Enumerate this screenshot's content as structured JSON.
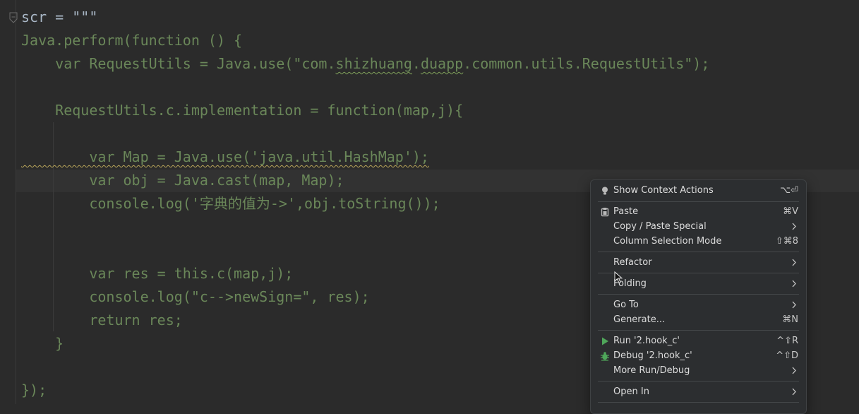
{
  "editor": {
    "lines": [
      {
        "id": "l1",
        "text": "scr = \"\"\""
      },
      {
        "id": "l2",
        "text": "Java.perform(function () {"
      },
      {
        "id": "l3a",
        "text": "    var RequestUtils = Java.use(\"com."
      },
      {
        "id": "l3b",
        "text": "shizhuang"
      },
      {
        "id": "l3c",
        "text": "."
      },
      {
        "id": "l3d",
        "text": "duapp"
      },
      {
        "id": "l3e",
        "text": ".common.utils.RequestUtils\");"
      },
      {
        "id": "l4",
        "text": "    RequestUtils.c.implementation = function(map,j){"
      },
      {
        "id": "l5",
        "text": "        var Map = Java.use('java.util.HashMap');"
      },
      {
        "id": "l6",
        "text": "        var obj = Java.cast(map, Map);"
      },
      {
        "id": "l7",
        "text": "        console.log('字典的值为->',obj.toString());"
      },
      {
        "id": "l8",
        "text": "        var res = this.c(map,j);"
      },
      {
        "id": "l9",
        "text": "        console.log(\"c-->newSign=\", res);"
      },
      {
        "id": "l10",
        "text": "        return res;"
      },
      {
        "id": "l11",
        "text": "    }"
      },
      {
        "id": "l12",
        "text": "});"
      }
    ],
    "colors": {
      "string": "#6a8759",
      "background": "#2b2b2b"
    }
  },
  "menu": {
    "items": {
      "show_context_actions": {
        "label": "Show Context Actions",
        "shortcut": "⌥⏎",
        "icon": "lightbulb-icon"
      },
      "paste": {
        "label": "Paste",
        "shortcut": "⌘V",
        "icon": "clipboard-icon"
      },
      "copy_paste_special": {
        "label": "Copy / Paste Special"
      },
      "column_selection_mode": {
        "label": "Column Selection Mode",
        "shortcut": "⇧⌘8"
      },
      "refactor": {
        "label": "Refactor"
      },
      "folding": {
        "label": "Folding"
      },
      "go_to": {
        "label": "Go To"
      },
      "generate": {
        "label": "Generate...",
        "shortcut": "⌘N"
      },
      "run": {
        "label": "Run '2.hook_c'",
        "shortcut": "^⇧R",
        "icon": "run-icon",
        "color": "#4fa65a"
      },
      "debug": {
        "label": "Debug '2.hook_c'",
        "shortcut": "^⇧D",
        "icon": "debug-icon",
        "color": "#4fa65a"
      },
      "more_run_debug": {
        "label": "More Run/Debug"
      },
      "open_in": {
        "label": "Open In"
      }
    }
  }
}
